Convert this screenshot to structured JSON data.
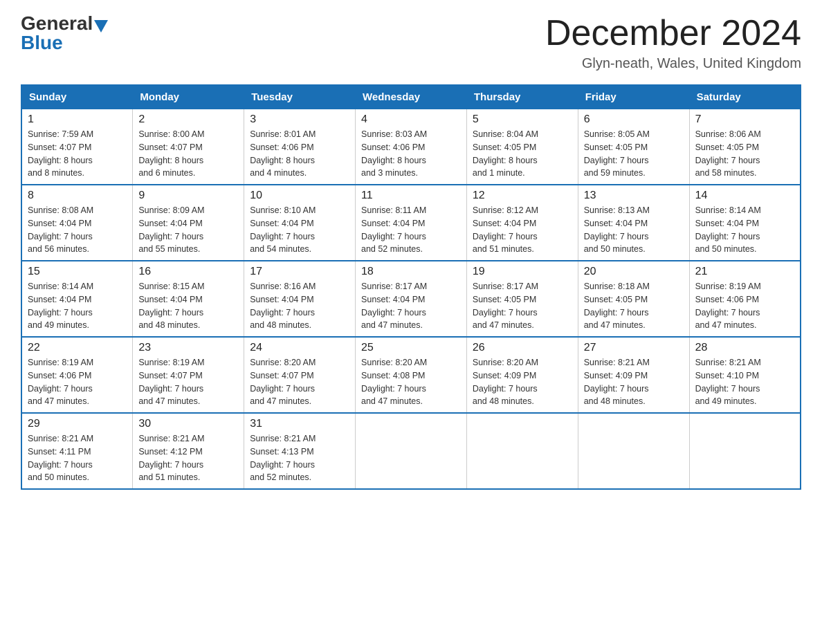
{
  "header": {
    "logo_general": "General",
    "logo_blue": "Blue",
    "month_title": "December 2024",
    "location": "Glyn-neath, Wales, United Kingdom"
  },
  "days_of_week": [
    "Sunday",
    "Monday",
    "Tuesday",
    "Wednesday",
    "Thursday",
    "Friday",
    "Saturday"
  ],
  "weeks": [
    [
      {
        "day": "1",
        "info": "Sunrise: 7:59 AM\nSunset: 4:07 PM\nDaylight: 8 hours\nand 8 minutes."
      },
      {
        "day": "2",
        "info": "Sunrise: 8:00 AM\nSunset: 4:07 PM\nDaylight: 8 hours\nand 6 minutes."
      },
      {
        "day": "3",
        "info": "Sunrise: 8:01 AM\nSunset: 4:06 PM\nDaylight: 8 hours\nand 4 minutes."
      },
      {
        "day": "4",
        "info": "Sunrise: 8:03 AM\nSunset: 4:06 PM\nDaylight: 8 hours\nand 3 minutes."
      },
      {
        "day": "5",
        "info": "Sunrise: 8:04 AM\nSunset: 4:05 PM\nDaylight: 8 hours\nand 1 minute."
      },
      {
        "day": "6",
        "info": "Sunrise: 8:05 AM\nSunset: 4:05 PM\nDaylight: 7 hours\nand 59 minutes."
      },
      {
        "day": "7",
        "info": "Sunrise: 8:06 AM\nSunset: 4:05 PM\nDaylight: 7 hours\nand 58 minutes."
      }
    ],
    [
      {
        "day": "8",
        "info": "Sunrise: 8:08 AM\nSunset: 4:04 PM\nDaylight: 7 hours\nand 56 minutes."
      },
      {
        "day": "9",
        "info": "Sunrise: 8:09 AM\nSunset: 4:04 PM\nDaylight: 7 hours\nand 55 minutes."
      },
      {
        "day": "10",
        "info": "Sunrise: 8:10 AM\nSunset: 4:04 PM\nDaylight: 7 hours\nand 54 minutes."
      },
      {
        "day": "11",
        "info": "Sunrise: 8:11 AM\nSunset: 4:04 PM\nDaylight: 7 hours\nand 52 minutes."
      },
      {
        "day": "12",
        "info": "Sunrise: 8:12 AM\nSunset: 4:04 PM\nDaylight: 7 hours\nand 51 minutes."
      },
      {
        "day": "13",
        "info": "Sunrise: 8:13 AM\nSunset: 4:04 PM\nDaylight: 7 hours\nand 50 minutes."
      },
      {
        "day": "14",
        "info": "Sunrise: 8:14 AM\nSunset: 4:04 PM\nDaylight: 7 hours\nand 50 minutes."
      }
    ],
    [
      {
        "day": "15",
        "info": "Sunrise: 8:14 AM\nSunset: 4:04 PM\nDaylight: 7 hours\nand 49 minutes."
      },
      {
        "day": "16",
        "info": "Sunrise: 8:15 AM\nSunset: 4:04 PM\nDaylight: 7 hours\nand 48 minutes."
      },
      {
        "day": "17",
        "info": "Sunrise: 8:16 AM\nSunset: 4:04 PM\nDaylight: 7 hours\nand 48 minutes."
      },
      {
        "day": "18",
        "info": "Sunrise: 8:17 AM\nSunset: 4:04 PM\nDaylight: 7 hours\nand 47 minutes."
      },
      {
        "day": "19",
        "info": "Sunrise: 8:17 AM\nSunset: 4:05 PM\nDaylight: 7 hours\nand 47 minutes."
      },
      {
        "day": "20",
        "info": "Sunrise: 8:18 AM\nSunset: 4:05 PM\nDaylight: 7 hours\nand 47 minutes."
      },
      {
        "day": "21",
        "info": "Sunrise: 8:19 AM\nSunset: 4:06 PM\nDaylight: 7 hours\nand 47 minutes."
      }
    ],
    [
      {
        "day": "22",
        "info": "Sunrise: 8:19 AM\nSunset: 4:06 PM\nDaylight: 7 hours\nand 47 minutes."
      },
      {
        "day": "23",
        "info": "Sunrise: 8:19 AM\nSunset: 4:07 PM\nDaylight: 7 hours\nand 47 minutes."
      },
      {
        "day": "24",
        "info": "Sunrise: 8:20 AM\nSunset: 4:07 PM\nDaylight: 7 hours\nand 47 minutes."
      },
      {
        "day": "25",
        "info": "Sunrise: 8:20 AM\nSunset: 4:08 PM\nDaylight: 7 hours\nand 47 minutes."
      },
      {
        "day": "26",
        "info": "Sunrise: 8:20 AM\nSunset: 4:09 PM\nDaylight: 7 hours\nand 48 minutes."
      },
      {
        "day": "27",
        "info": "Sunrise: 8:21 AM\nSunset: 4:09 PM\nDaylight: 7 hours\nand 48 minutes."
      },
      {
        "day": "28",
        "info": "Sunrise: 8:21 AM\nSunset: 4:10 PM\nDaylight: 7 hours\nand 49 minutes."
      }
    ],
    [
      {
        "day": "29",
        "info": "Sunrise: 8:21 AM\nSunset: 4:11 PM\nDaylight: 7 hours\nand 50 minutes."
      },
      {
        "day": "30",
        "info": "Sunrise: 8:21 AM\nSunset: 4:12 PM\nDaylight: 7 hours\nand 51 minutes."
      },
      {
        "day": "31",
        "info": "Sunrise: 8:21 AM\nSunset: 4:13 PM\nDaylight: 7 hours\nand 52 minutes."
      },
      null,
      null,
      null,
      null
    ]
  ]
}
